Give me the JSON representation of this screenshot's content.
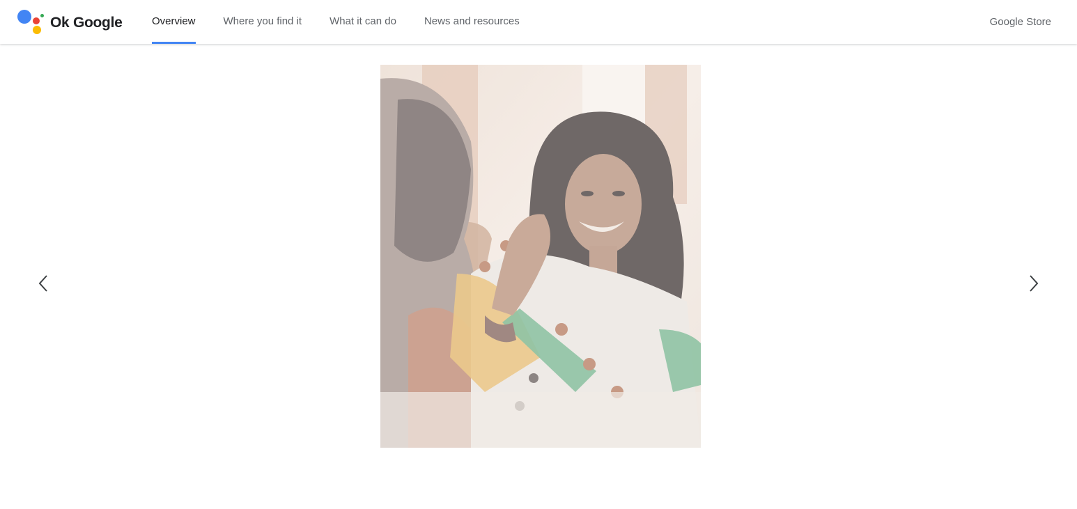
{
  "app": {
    "title": "Ok Google"
  },
  "colors": {
    "brand_blue": "#4285f4",
    "brand_red": "#ea4335",
    "brand_yellow": "#fbbc04",
    "brand_green": "#34a853",
    "nav_active_underline": "#4285f4",
    "text_primary": "#202124",
    "text_secondary": "#5f6368"
  },
  "header": {
    "logo_text": "Ok Google",
    "logo_icon": "google-assistant-dots-icon",
    "nav": {
      "items": [
        {
          "label": "Overview",
          "active": true
        },
        {
          "label": "Where you find it",
          "active": false
        },
        {
          "label": "What it can do",
          "active": false
        },
        {
          "label": "News and resources",
          "active": false
        }
      ]
    },
    "store_label": "Google Store"
  },
  "carousel": {
    "prev_icon": "chevron-left-icon",
    "next_icon": "chevron-right-icon",
    "slide_image": "photo-woman-laughing-in-conversation"
  }
}
